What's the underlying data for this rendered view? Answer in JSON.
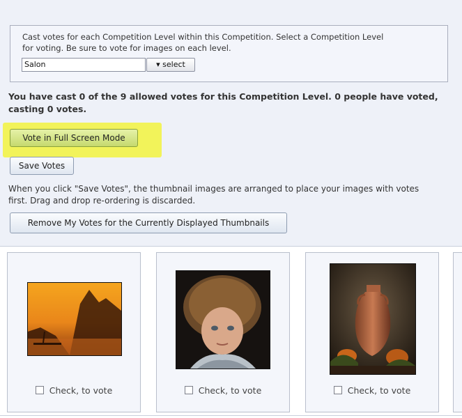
{
  "instructions": {
    "line1": "Cast votes for each Competition Level within this Competition. Select a Competition Level",
    "line2": "for voting. Be sure to vote for images on each level."
  },
  "level_select": {
    "value": "Salon",
    "button_label": "▾ select"
  },
  "status": {
    "line1": "You have cast 0 of the 9 allowed votes for this Competition Level. 0 people have voted,",
    "line2": "casting 0 votes."
  },
  "buttons": {
    "full_screen": "Vote in Full Screen Mode",
    "save_votes": "Save Votes",
    "remove_votes": "Remove My Votes for the Currently Displayed Thumbnails"
  },
  "help": {
    "line1": "When you click \"Save Votes\", the thumbnail images are arranged to place your images with votes",
    "line2": "first. Drag and drop re-ordering is discarded."
  },
  "thumbnails": [
    {
      "vote_label": "Check, to vote",
      "checked": false
    },
    {
      "vote_label": "Check, to vote",
      "checked": false
    },
    {
      "vote_label": "Check, to vote",
      "checked": false
    }
  ],
  "colors": {
    "highlight": "#f2f35a",
    "panel_bg": "#eef1f8"
  }
}
